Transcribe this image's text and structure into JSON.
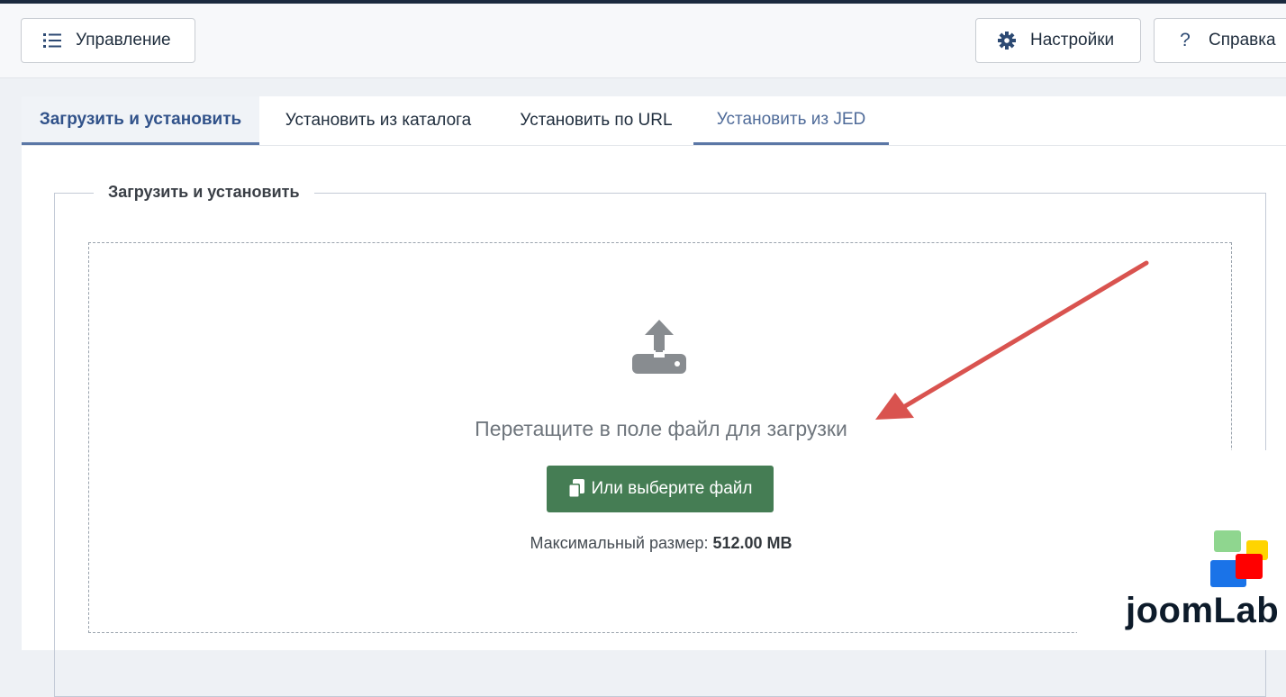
{
  "toolbar": {
    "manage_label": "Управление",
    "settings_label": "Настройки",
    "help_label": "Справка"
  },
  "tabs": [
    {
      "label": "Загрузить и установить"
    },
    {
      "label": "Установить из каталога"
    },
    {
      "label": "Установить по URL"
    },
    {
      "label": "Установить из JED"
    }
  ],
  "upload": {
    "legend": "Загрузить и установить",
    "drop_text": "Перетащите в поле файл для загрузки",
    "choose_button": "Или выберите файл",
    "max_size_label": "Максимальный размер:",
    "max_size_value": "512.00 MB"
  },
  "logo": {
    "text": "joomLab",
    "colors": [
      "#8fd68f",
      "#ffd400",
      "#ff0000",
      "#1a73e8"
    ]
  },
  "colors": {
    "accent_blue": "#31528a",
    "button_green": "#457d54",
    "annotation_arrow": "#d9534f"
  }
}
